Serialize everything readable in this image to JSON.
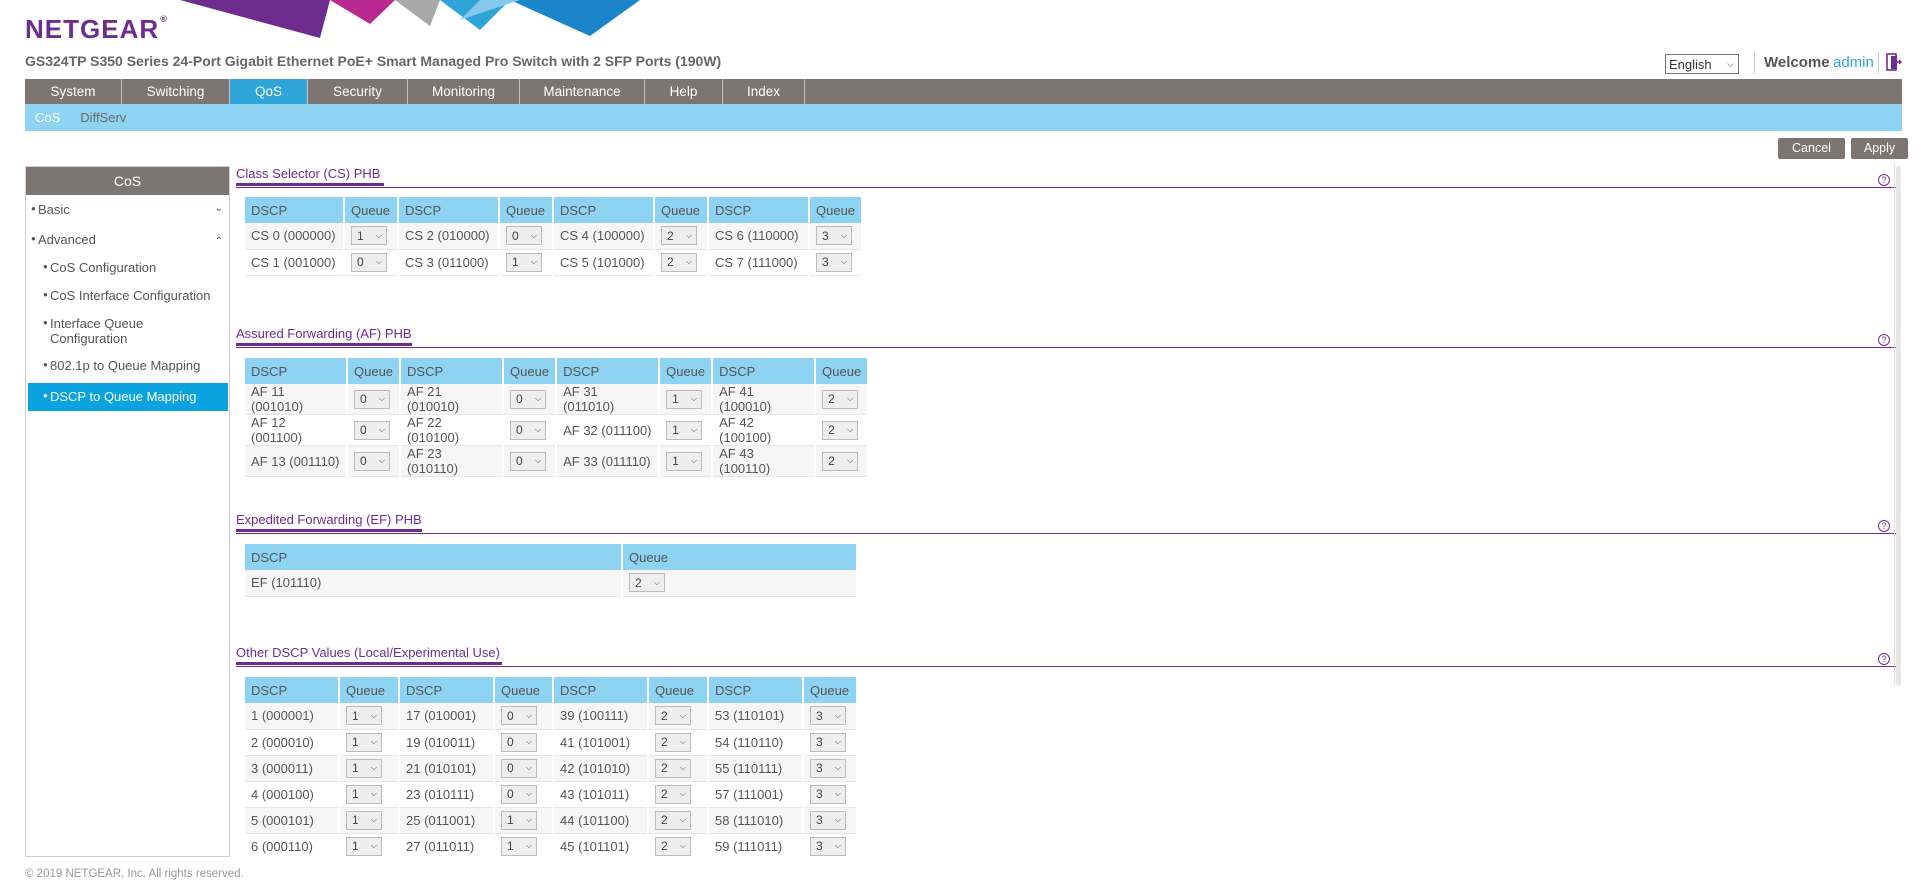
{
  "brand": {
    "logo": "NETGEAR",
    "logo_mark": "®"
  },
  "product_title": "GS324TP S350 Series 24-Port Gigabit Ethernet PoE+ Smart Managed Pro Switch with 2 SFP Ports (190W)",
  "header": {
    "language": "English",
    "welcome_label": "Welcome",
    "user": "admin"
  },
  "main_nav": [
    {
      "label": "System"
    },
    {
      "label": "Switching"
    },
    {
      "label": "QoS"
    },
    {
      "label": "Security"
    },
    {
      "label": "Monitoring"
    },
    {
      "label": "Maintenance"
    },
    {
      "label": "Help"
    },
    {
      "label": "Index"
    }
  ],
  "main_nav_active": "QoS",
  "sub_nav": [
    {
      "label": "CoS"
    },
    {
      "label": "DiffServ"
    }
  ],
  "actions": {
    "cancel": "Cancel",
    "apply": "Apply"
  },
  "sidebar": {
    "title": "CoS",
    "items": [
      {
        "label": "Basic"
      },
      {
        "label": "Advanced"
      },
      {
        "label": "CoS Configuration"
      },
      {
        "label": "CoS Interface Configuration"
      },
      {
        "label": "Interface Queue Configuration"
      },
      {
        "label": "802.1p to Queue Mapping"
      },
      {
        "label": "DSCP to Queue Mapping"
      }
    ]
  },
  "sections": {
    "cs": {
      "title": "Class Selector (CS) PHB",
      "headers": [
        "DSCP",
        "Queue",
        "DSCP",
        "Queue",
        "DSCP",
        "Queue",
        "DSCP",
        "Queue"
      ],
      "rows": [
        [
          "CS 0 (000000)",
          "1",
          "CS 2 (010000)",
          "0",
          "CS 4 (100000)",
          "2",
          "CS 6 (110000)",
          "3"
        ],
        [
          "CS 1 (001000)",
          "0",
          "CS 3 (011000)",
          "1",
          "CS 5 (101000)",
          "2",
          "CS 7 (111000)",
          "3"
        ]
      ]
    },
    "af": {
      "title": "Assured Forwarding (AF) PHB",
      "headers": [
        "DSCP",
        "Queue",
        "DSCP",
        "Queue",
        "DSCP",
        "Queue",
        "DSCP",
        "Queue"
      ],
      "rows": [
        [
          "AF 11 (001010)",
          "0",
          "AF 21 (010010)",
          "0",
          "AF 31 (011010)",
          "1",
          "AF 41 (100010)",
          "2"
        ],
        [
          "AF 12 (001100)",
          "0",
          "AF 22 (010100)",
          "0",
          "AF 32 (011100)",
          "1",
          "AF 42 (100100)",
          "2"
        ],
        [
          "AF 13 (001110)",
          "0",
          "AF 23 (010110)",
          "0",
          "AF 33 (011110)",
          "1",
          "AF 43 (100110)",
          "2"
        ]
      ]
    },
    "ef": {
      "title": "Expedited Forwarding (EF) PHB",
      "headers": [
        "DSCP",
        "Queue"
      ],
      "rows": [
        [
          "EF (101110)",
          "2"
        ]
      ]
    },
    "other": {
      "title": "Other DSCP Values (Local/Experimental Use)",
      "headers": [
        "DSCP",
        "Queue",
        "DSCP",
        "Queue",
        "DSCP",
        "Queue",
        "DSCP",
        "Queue"
      ],
      "rows": [
        [
          "1 (000001)",
          "1",
          "17 (010001)",
          "0",
          "39 (100111)",
          "2",
          "53 (110101)",
          "3"
        ],
        [
          "2 (000010)",
          "1",
          "19 (010011)",
          "0",
          "41 (101001)",
          "2",
          "54 (110110)",
          "3"
        ],
        [
          "3 (000011)",
          "1",
          "21 (010101)",
          "0",
          "42 (101010)",
          "2",
          "55 (110111)",
          "3"
        ],
        [
          "4 (000100)",
          "1",
          "23 (010111)",
          "0",
          "43 (101011)",
          "2",
          "57 (111001)",
          "3"
        ],
        [
          "5 (000101)",
          "1",
          "25 (011001)",
          "1",
          "44 (101100)",
          "2",
          "58 (111010)",
          "3"
        ],
        [
          "6 (000110)",
          "1",
          "27 (011011)",
          "1",
          "45 (101101)",
          "2",
          "59 (111011)",
          "3"
        ]
      ]
    }
  },
  "footer": "© 2019 NETGEAR, Inc. All rights reserved.",
  "colors": {
    "purple": "#6e2c8f",
    "nav_gray": "#7d7571",
    "accent_blue": "#2ea4d7",
    "light_blue": "#8ed3f2"
  }
}
